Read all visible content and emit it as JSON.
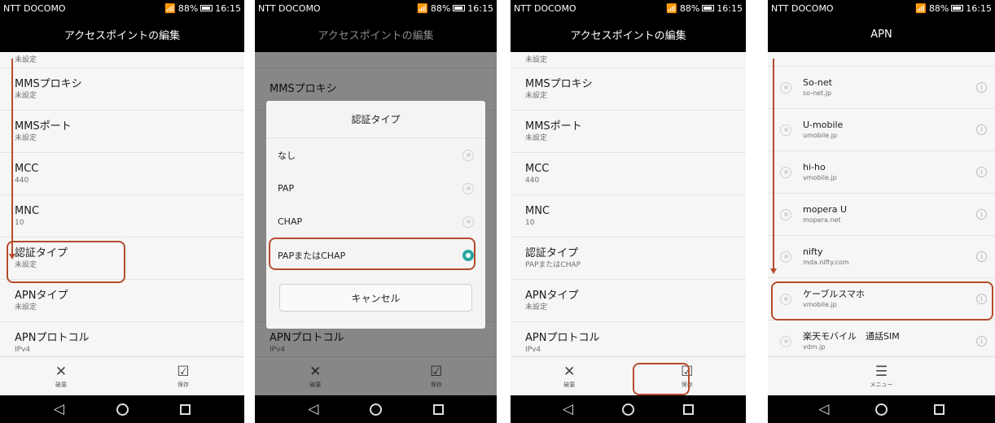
{
  "status": {
    "carrier": "NTT DOCOMO",
    "signal": "88%",
    "time": "16:15"
  },
  "panel1": {
    "title": "アクセスポイントの編集",
    "partial_value": "未設定",
    "rows": [
      {
        "label": "MMSプロキシ",
        "value": "未設定"
      },
      {
        "label": "MMSポート",
        "value": "未設定"
      },
      {
        "label": "MCC",
        "value": "440"
      },
      {
        "label": "MNC",
        "value": "10"
      },
      {
        "label": "認証タイプ",
        "value": "未設定"
      },
      {
        "label": "APNタイプ",
        "value": "未設定"
      },
      {
        "label": "APNプロトコル",
        "value": "IPv4"
      }
    ],
    "bottom": {
      "discard": "破棄",
      "save": "保存"
    }
  },
  "panel2": {
    "title": "アクセスポイントの編集",
    "bg_rows": [
      {
        "label": "MMSプロキシ",
        "value": ""
      },
      {
        "label": "APNプロトコル",
        "value": "IPv4"
      }
    ],
    "dialog": {
      "title": "認証タイプ",
      "options": [
        "なし",
        "PAP",
        "CHAP",
        "PAPまたはCHAP"
      ],
      "selected": "PAPまたはCHAP",
      "cancel": "キャンセル"
    },
    "bottom": {
      "discard": "破棄",
      "save": "保存"
    }
  },
  "panel3": {
    "title": "アクセスポイントの編集",
    "partial_value": "未設定",
    "rows": [
      {
        "label": "MMSプロキシ",
        "value": "未設定"
      },
      {
        "label": "MMSポート",
        "value": "未設定"
      },
      {
        "label": "MCC",
        "value": "440"
      },
      {
        "label": "MNC",
        "value": "10"
      },
      {
        "label": "認証タイプ",
        "value": "PAPまたはCHAP"
      },
      {
        "label": "APNタイプ",
        "value": "未設定"
      },
      {
        "label": "APNプロトコル",
        "value": "IPv4"
      }
    ],
    "bottom": {
      "discard": "破棄",
      "save": "保存"
    }
  },
  "panel4": {
    "title": "APN",
    "items": [
      {
        "name": "So-net",
        "apn": "so-net.jp"
      },
      {
        "name": "U-mobile",
        "apn": "umobile.jp"
      },
      {
        "name": "hi-ho",
        "apn": "vmobile.jp"
      },
      {
        "name": "mopera U",
        "apn": "mopera.net"
      },
      {
        "name": "nifty",
        "apn": "mda.nifty.com"
      },
      {
        "name": "ケーブルスマホ",
        "apn": "vmobile.jp"
      },
      {
        "name": "楽天モバイル　通話SIM",
        "apn": "vdm.jp"
      }
    ],
    "bottom": {
      "menu": "メニュー"
    }
  },
  "colors": {
    "highlight": "#b54c2c",
    "radio_selected": "#2aa5a0"
  },
  "icons": {
    "discard": "close-x-icon",
    "save": "checkbox-check-icon",
    "menu": "hamburger-icon",
    "back": "triangle-back-icon",
    "home": "circle-home-icon",
    "recent": "square-recent-icon",
    "info": "info-circle-icon"
  }
}
